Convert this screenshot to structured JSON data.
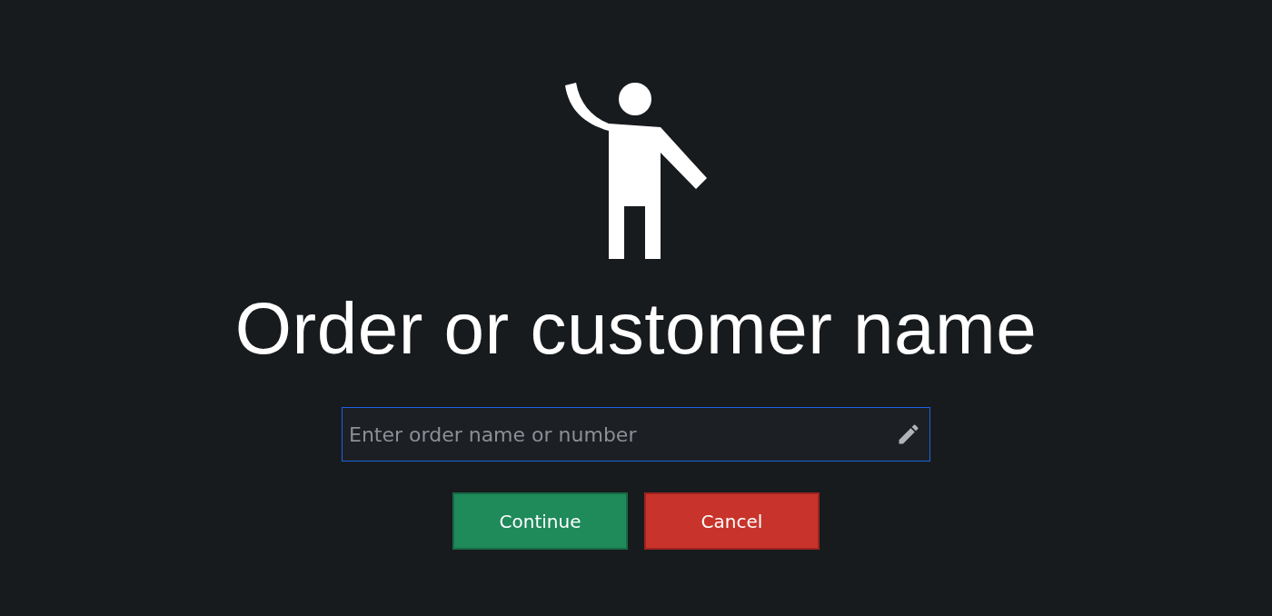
{
  "heading": "Order or customer name",
  "search": {
    "placeholder": "Enter order name or number",
    "focused": true
  },
  "buttons": [
    {
      "label": "Continue",
      "kind": "confirm"
    },
    {
      "label": "Cancel",
      "kind": "cancel"
    }
  ]
}
